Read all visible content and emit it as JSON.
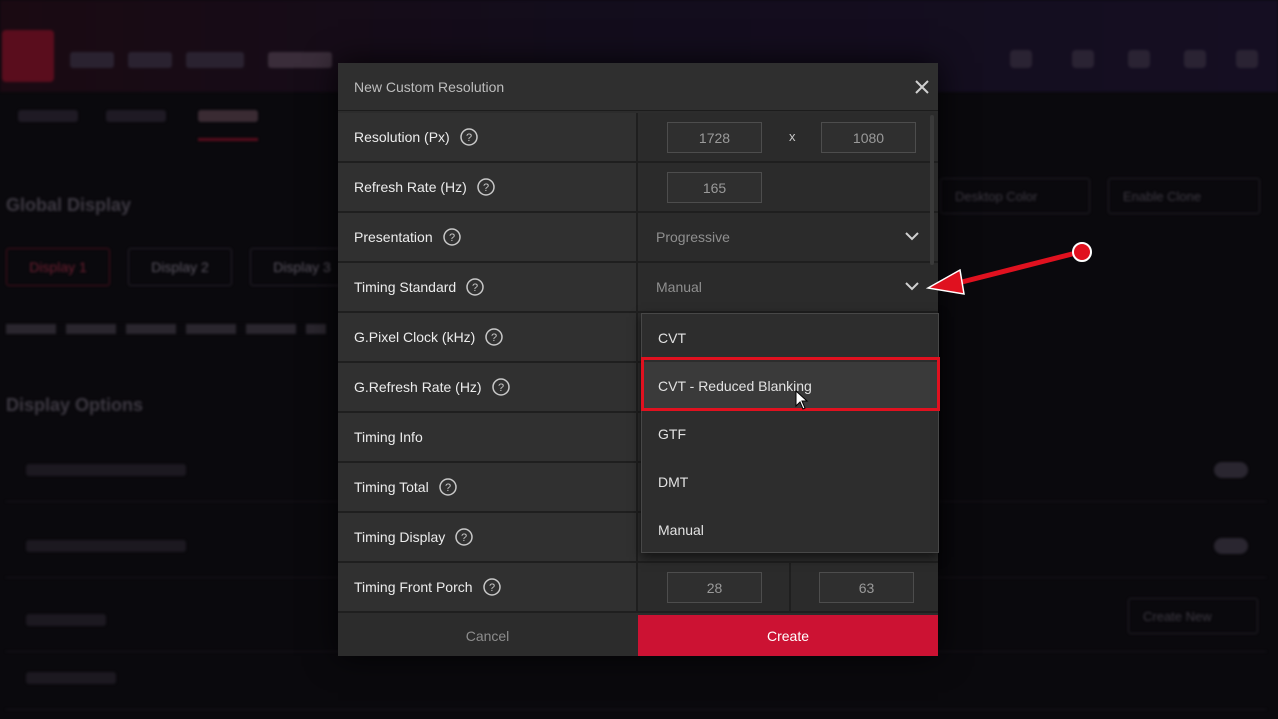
{
  "background": {
    "sections": {
      "global_display": "Global Display",
      "display_options": "Display Options"
    },
    "display_tabs": [
      "Display 1",
      "Display 2",
      "Display 3"
    ],
    "right_buttons": {
      "desktop_color": "Desktop Color",
      "enable_clone": "Enable Clone"
    },
    "create_new": "Create New"
  },
  "modal": {
    "title": "New Custom Resolution",
    "rows": [
      {
        "label": "Resolution (Px)",
        "help": true,
        "type": "pair",
        "v1": "1728",
        "v2": "1080",
        "sep": "x"
      },
      {
        "label": "Refresh Rate (Hz)",
        "help": true,
        "type": "single",
        "v1": "165"
      },
      {
        "label": "Presentation",
        "help": true,
        "type": "select",
        "value": "Progressive"
      },
      {
        "label": "Timing Standard",
        "help": true,
        "type": "select",
        "value": "Manual"
      },
      {
        "label": "G.Pixel Clock (kHz)",
        "help": true,
        "type": "none"
      },
      {
        "label": "G.Refresh Rate (Hz)",
        "help": true,
        "type": "none"
      },
      {
        "label": "Timing Info",
        "help": false,
        "type": "none"
      },
      {
        "label": "Timing Total",
        "help": true,
        "type": "none"
      },
      {
        "label": "Timing Display",
        "help": true,
        "type": "none"
      },
      {
        "label": "Timing Front Porch",
        "help": true,
        "type": "pair2",
        "v1": "28",
        "v2": "63"
      }
    ],
    "cancel_label": "Cancel",
    "create_label": "Create"
  },
  "dropdown": {
    "options": [
      "CVT",
      "CVT - Reduced Blanking",
      "GTF",
      "DMT",
      "Manual"
    ],
    "hovered": "CVT - Reduced Blanking"
  },
  "colors": {
    "accent": "#cc1233",
    "highlight": "#e0111f",
    "annotation_arrow": "#e0111f"
  },
  "icons": [
    "close-icon",
    "help-icon",
    "chevron-down-icon",
    "mouse-cursor-icon",
    "annotation-arrow-icon"
  ]
}
